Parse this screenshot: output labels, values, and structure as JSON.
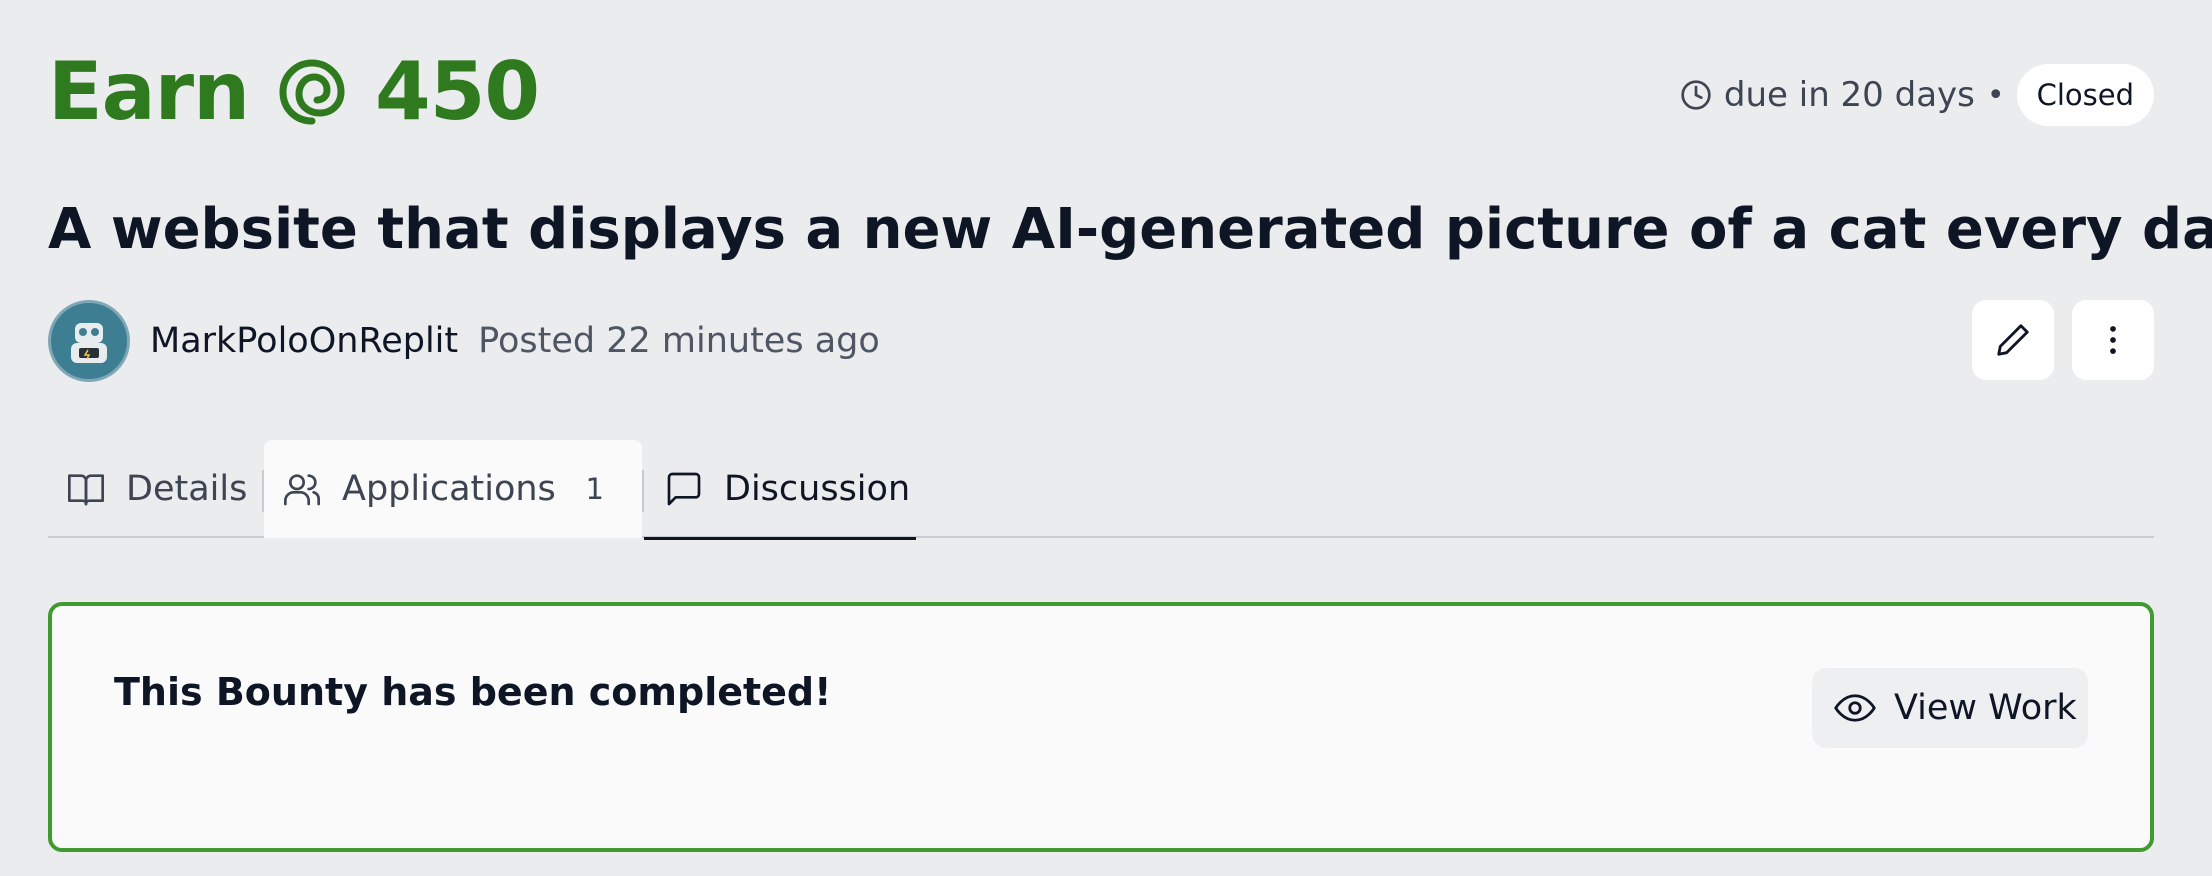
{
  "bounty": {
    "earn_label": "Earn",
    "amount": "450",
    "currency_icon": "cycles-spiral-icon",
    "due_text": "due in 20 days",
    "separator": "•",
    "status_badge": "Closed",
    "title": "A website that displays a new AI-generated picture of a cat every day"
  },
  "author": {
    "name": "MarkPoloOnReplit",
    "posted": "Posted 22 minutes ago",
    "avatar_icon": "robot-avatar"
  },
  "actions": {
    "edit_icon": "pencil-icon",
    "more_icon": "more-vertical-icon"
  },
  "tabs": [
    {
      "label": "Details",
      "icon": "book-open-icon"
    },
    {
      "label": "Applications",
      "icon": "users-icon",
      "count": "1"
    },
    {
      "label": "Discussion",
      "icon": "message-square-icon",
      "active": true
    }
  ],
  "completion": {
    "message": "This Bounty has been completed!",
    "view_work_label": "View Work",
    "view_icon": "eye-icon"
  },
  "colors": {
    "accent_green": "#2f7a1f",
    "card_border": "#3f9a2f",
    "background": "#ebecee"
  }
}
